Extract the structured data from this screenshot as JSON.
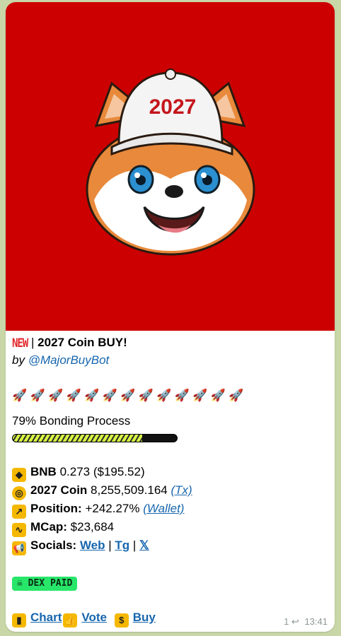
{
  "post": {
    "new_badge": "NEW",
    "title_sep": " | ",
    "title": "2027 Coin BUY!",
    "by_label": "by ",
    "bot_handle": "@MajorBuyBot",
    "rockets": [
      "🚀",
      "🚀",
      "🚀",
      "🚀",
      "🚀",
      "🚀",
      "🚀",
      "🚀",
      "🚀",
      "🚀",
      "🚀",
      "🚀",
      "🚀"
    ],
    "bonding": {
      "label": "79% Bonding Process",
      "progress": 0.79
    },
    "bnb": {
      "label": "BNB",
      "value": " 0.273 ($195.52)"
    },
    "coin": {
      "label": "2027 Coin",
      "value": " 8,255,509.164 ",
      "link": "(Tx)"
    },
    "position": {
      "label": "Position:",
      "value": " +242.27% ",
      "link": "(Wallet)"
    },
    "mcap": {
      "label": "MCap:",
      "value": " $23,684"
    },
    "socials": {
      "label": "Socials:",
      "web": "Web",
      "tg": "Tg",
      "x": "𝕏",
      "sep": " | "
    },
    "dex_paid": "DEX PAID",
    "actions": {
      "chart": "Chart",
      "vote": "Vote",
      "buy": "Buy"
    }
  },
  "image": {
    "cap_text": "2027",
    "background": "#cc0000"
  },
  "meta": {
    "replies": "1",
    "time": "13:41"
  },
  "colors": {
    "link": "#1766ae",
    "accent_icon": "#f5b800",
    "dex": "#27e66a"
  }
}
